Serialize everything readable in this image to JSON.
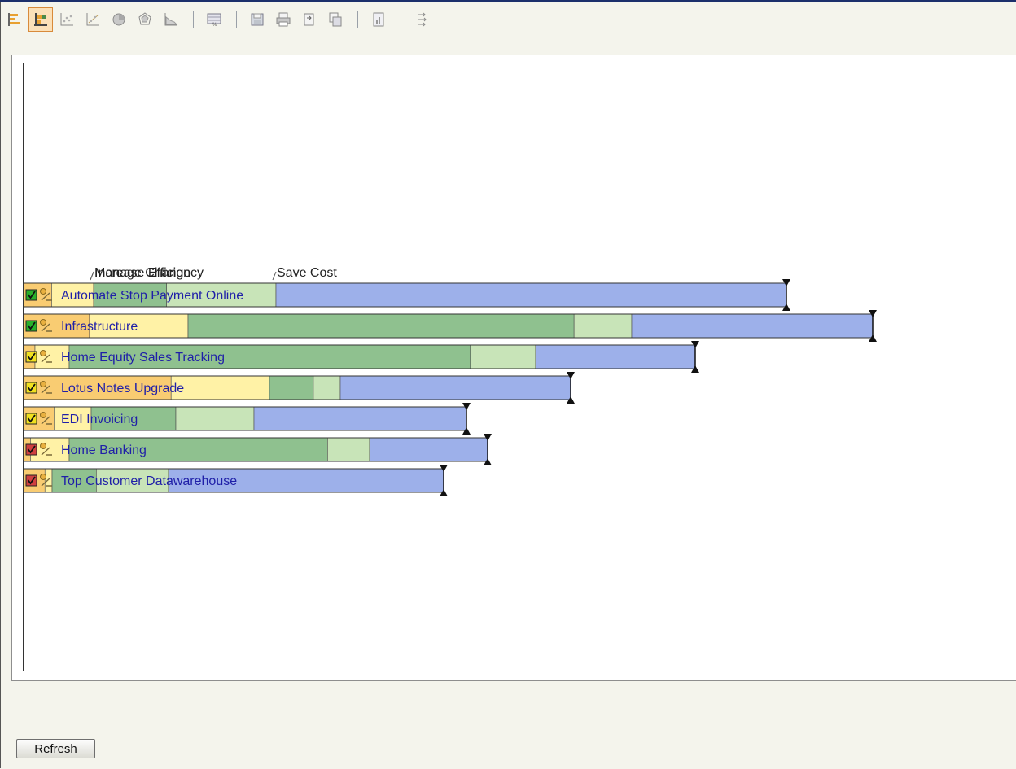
{
  "toolbar": {
    "buttons": [
      {
        "icon": "horizontal-bar-chart-icon",
        "active": false
      },
      {
        "icon": "stacked-bar-chart-icon",
        "active": true
      },
      {
        "icon": "scatter-chart-icon",
        "active": false
      },
      {
        "icon": "line-scatter-chart-icon",
        "active": false
      },
      {
        "icon": "pie-chart-icon",
        "active": false
      },
      {
        "icon": "radar-chart-icon",
        "active": false
      },
      {
        "icon": "area-chart-icon",
        "active": false
      },
      {
        "icon": "percent-table-icon",
        "active": false
      },
      {
        "icon": "save-icon",
        "active": false
      },
      {
        "icon": "print-icon",
        "active": false
      },
      {
        "icon": "export-icon",
        "active": false
      },
      {
        "icon": "copy-icon",
        "active": false
      },
      {
        "icon": "report-icon",
        "active": false
      },
      {
        "icon": "settings-icon",
        "active": false
      }
    ]
  },
  "colors": {
    "increase_efficiency": [
      "#f9cc72",
      "#fff2a6"
    ],
    "manage_change": [
      "#8fc18f",
      "#c8e4b8"
    ],
    "save_cost": "#9db0ea",
    "label": "#1f1fa8",
    "status_green": "#2ab02a",
    "status_red": "#d04040",
    "status_yellow": "#f0e020"
  },
  "chart_data": {
    "type": "bar",
    "orientation": "horizontal",
    "stacked": true,
    "group_labels": [
      "Increase Efficiency",
      "Manage Change",
      "Save Cost"
    ],
    "categories": [
      "Automate Stop Payment Online",
      "Infrastructure",
      "Home Equity Sales Tracking",
      "Lotus Notes Upgrade",
      "EDI Invoicing",
      "Home Banking",
      "Top Customer Datawarehouse"
    ],
    "status": [
      "green",
      "green",
      "yellow",
      "yellow",
      "yellow",
      "red",
      "red"
    ],
    "series": [
      {
        "name": "Increase Efficiency",
        "values": [
          86,
          202,
          56,
          302,
          83,
          56,
          35
        ],
        "split": [
          0.4,
          0.4,
          0.25,
          0.6,
          0.45,
          0.15,
          0.75
        ]
      },
      {
        "name": "Manage Change",
        "values": [
          224,
          545,
          573,
          87,
          200,
          369,
          143
        ],
        "split": [
          0.4,
          0.87,
          0.86,
          0.62,
          0.52,
          0.86,
          0.38
        ]
      },
      {
        "name": "Save Cost",
        "values": [
          627,
          296,
          196,
          283,
          261,
          145,
          338
        ]
      }
    ]
  },
  "footer": {
    "refresh_label": "Refresh"
  }
}
